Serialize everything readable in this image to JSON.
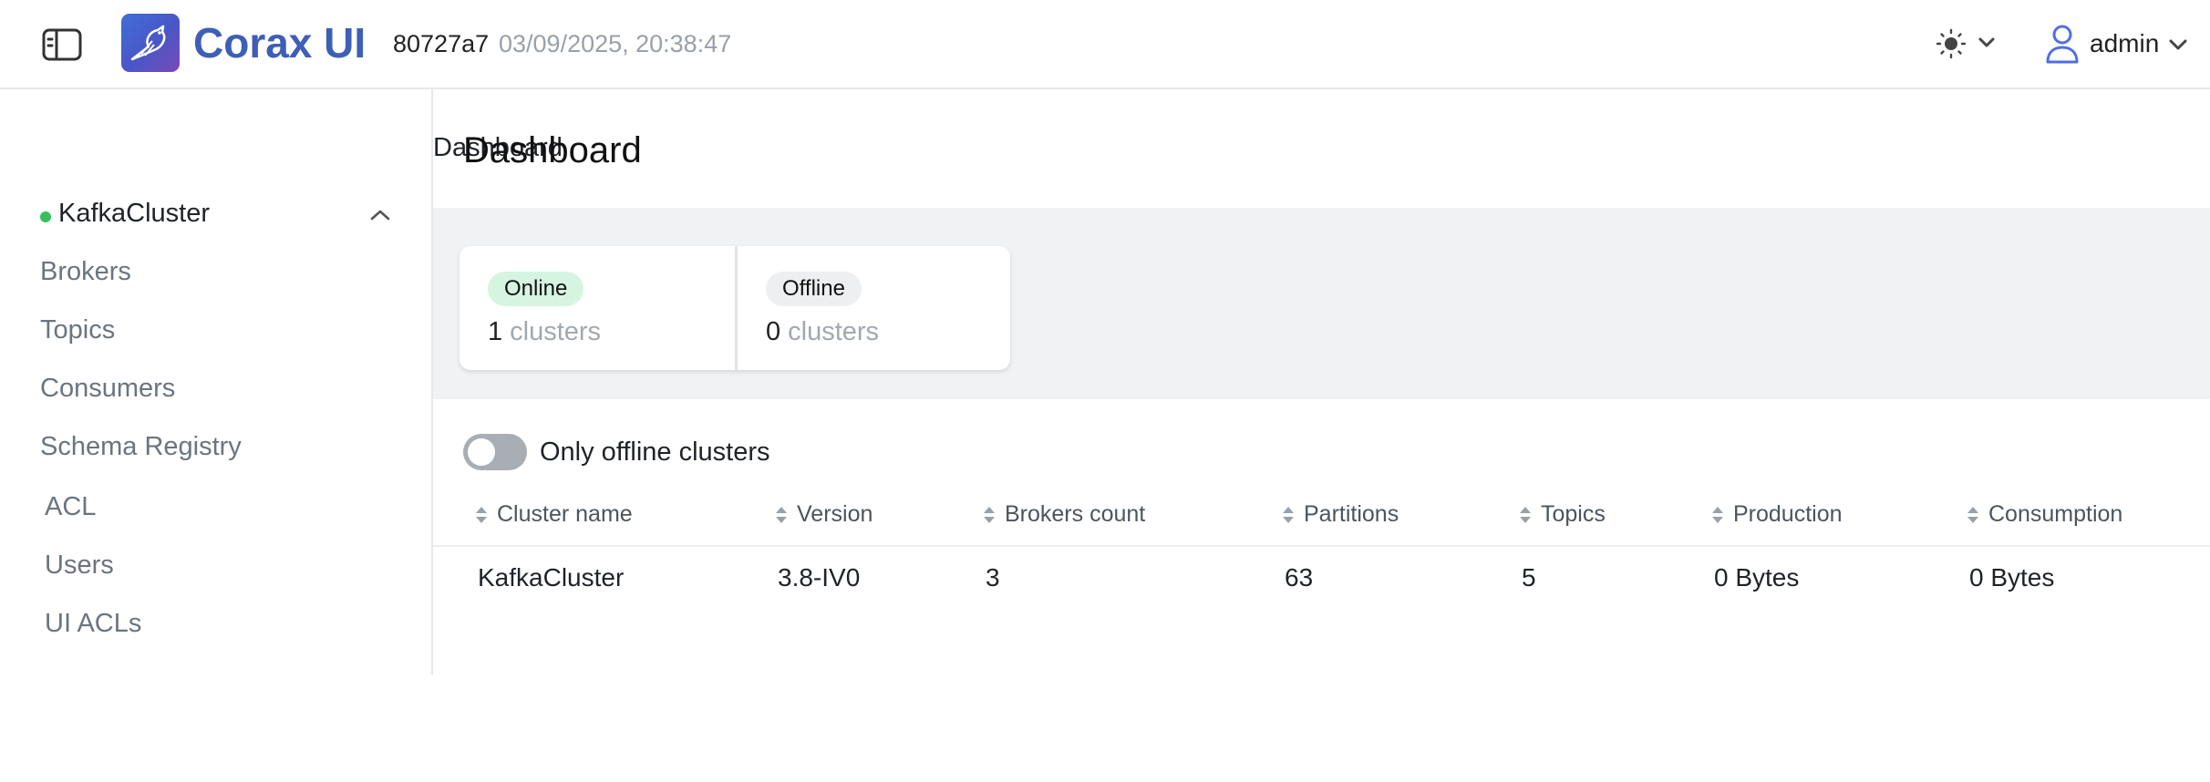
{
  "header": {
    "brand": "Corax UI",
    "version_hash": "80727a7",
    "version_date": "03/09/2025, 20:38:47",
    "user": "admin",
    "icons": [
      "sidebar-toggle-icon",
      "logo-bird-icon",
      "sun-icon",
      "chevron-down-icon",
      "user-icon"
    ]
  },
  "sidebar": {
    "dashboard": "Dashboard",
    "cluster": {
      "name": "KafkaCluster",
      "status_color": "#34c05a"
    },
    "items": [
      "Brokers",
      "Topics",
      "Consumers",
      "Schema Registry"
    ],
    "admin_items": [
      "ACL",
      "Users",
      "UI ACLs"
    ]
  },
  "main": {
    "title": "Dashboard",
    "stats": {
      "online": {
        "label": "Online",
        "count": "1",
        "unit": "clusters"
      },
      "offline": {
        "label": "Offline",
        "count": "0",
        "unit": "clusters"
      }
    },
    "filter_toggle": {
      "label": "Only offline clusters",
      "checked": false
    },
    "table": {
      "columns": [
        "Cluster name",
        "Version",
        "Brokers count",
        "Partitions",
        "Topics",
        "Production",
        "Consumption"
      ],
      "rows": [
        [
          "KafkaCluster",
          "3.8-IV0",
          "3",
          "63",
          "5",
          "0 Bytes",
          "0 Bytes"
        ]
      ]
    }
  },
  "colors": {
    "brand": "#3e5fb5",
    "online_pill": "#d6f5e0",
    "offline_pill": "#eeeff1",
    "accent_user": "#4f6ee8"
  }
}
